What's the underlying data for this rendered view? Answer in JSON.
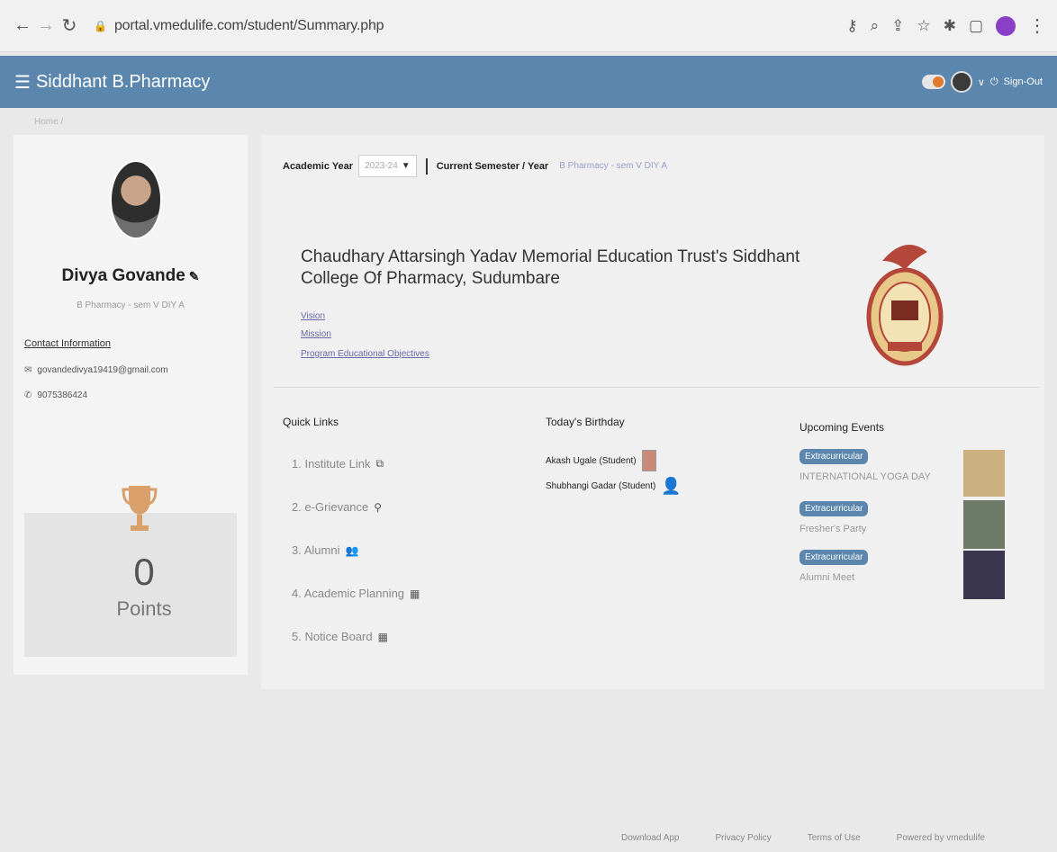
{
  "browser": {
    "url": "portal.vmedulife.com/student/Summary.php"
  },
  "header": {
    "title": "Siddhant B.Pharmacy",
    "signout_label": "Sign-Out"
  },
  "breadcrumb": "Home /",
  "profile": {
    "name": "Divya Govande",
    "program": "B Pharmacy - sem V DIY A",
    "contact_title": "Contact Information",
    "email": "govandedivya19419@gmail.com",
    "phone": "9075386424",
    "points_value": "0",
    "points_label": "Points"
  },
  "academic": {
    "year_label": "Academic Year",
    "year_value": "2023-24",
    "semester_label": "Current Semester / Year",
    "semester_value": "B Pharmacy - sem V DIY A"
  },
  "college": {
    "name": "Chaudhary Attarsingh Yadav Memorial Education Trust's Siddhant College Of Pharmacy, Sudumbare",
    "links": [
      "Vision",
      "Mission",
      "Program Educational Objectives"
    ]
  },
  "quick_links": {
    "title": "Quick Links",
    "items": [
      {
        "label": "1. Institute Link",
        "icon": "external-link-icon"
      },
      {
        "label": "2. e-Grievance",
        "icon": "tie-icon"
      },
      {
        "label": "3. Alumni",
        "icon": "users-icon"
      },
      {
        "label": "4. Academic Planning",
        "icon": "calendar-icon"
      },
      {
        "label": "5. Notice Board",
        "icon": "calendar-icon"
      }
    ]
  },
  "birthdays": {
    "title": "Today's Birthday",
    "items": [
      {
        "name": "Akash Ugale (Student)"
      },
      {
        "name": "Shubhangi Gadar (Student)"
      }
    ]
  },
  "events": {
    "title": "Upcoming Events",
    "items": [
      {
        "badge": "Extracurricular",
        "title": "INTERNATIONAL YOGA DAY"
      },
      {
        "badge": "Extracurricular",
        "title": "Fresher's Party"
      },
      {
        "badge": "Extracurricular",
        "title": "Alumni Meet"
      }
    ]
  },
  "footer": {
    "download": "Download App",
    "privacy": "Privacy Policy",
    "terms": "Terms of Use",
    "powered": "Powered by vmedulife"
  },
  "colors": {
    "header_bg": "#5b86ad",
    "link": "#6a6aa8",
    "badge": "#5b86ad"
  }
}
